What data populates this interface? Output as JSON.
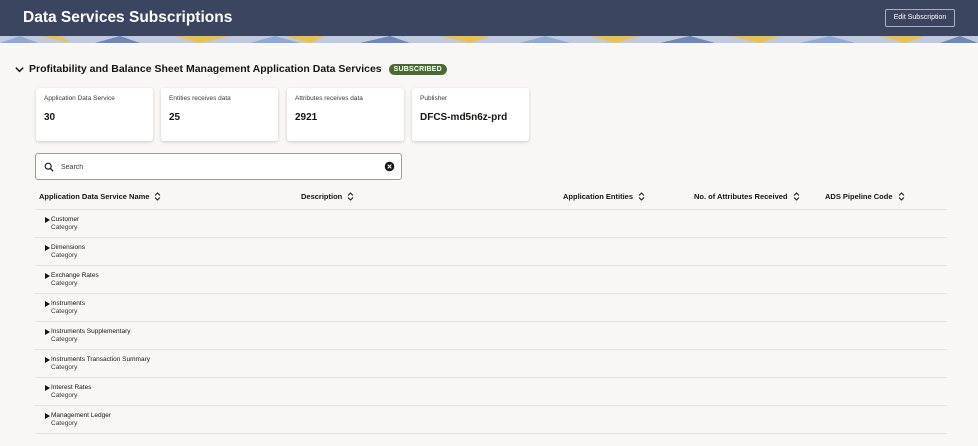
{
  "header": {
    "title": "Data Services Subscriptions",
    "edit_button": "Edit Subscription"
  },
  "section": {
    "title": "Profitability and Balance Sheet Management Application Data Services",
    "status_badge": "SUBSCRIBED"
  },
  "summary_cards": [
    {
      "label": "Application Data Service",
      "value": "30"
    },
    {
      "label": "Entities receives data",
      "value": "25"
    },
    {
      "label": "Attributes receives data",
      "value": "2921"
    },
    {
      "label": "Publisher",
      "value": "DFCS-md5n6z-prd"
    }
  ],
  "search": {
    "placeholder": "Search",
    "value": ""
  },
  "table": {
    "columns": [
      "Application Data Service Name",
      "Description",
      "Application Entities",
      "No. of Attributes Received",
      "ADS Pipeline Code"
    ],
    "rows": [
      {
        "name": "Customer",
        "type": "Category"
      },
      {
        "name": "Dimensions",
        "type": "Category"
      },
      {
        "name": "Exchange Rates",
        "type": "Category"
      },
      {
        "name": "Instruments",
        "type": "Category"
      },
      {
        "name": "Instruments Supplementary",
        "type": "Category"
      },
      {
        "name": "Instruments Transaction Summary",
        "type": "Category"
      },
      {
        "name": "Interest Rates",
        "type": "Category"
      },
      {
        "name": "Management Ledger",
        "type": "Category"
      }
    ]
  },
  "colors": {
    "header_bg": "#3c4560",
    "badge_bg": "#4a6b2f",
    "page_bg": "#f9f7f5",
    "band_yellow": "#e8c24a",
    "band_blue": "#8fa8d8"
  },
  "icons": {
    "collapse": "chevron-down-icon",
    "search": "search-icon",
    "clear": "clear-circle-x-icon",
    "sort": "sort-updown-icon",
    "expand_row": "caret-right-icon"
  }
}
